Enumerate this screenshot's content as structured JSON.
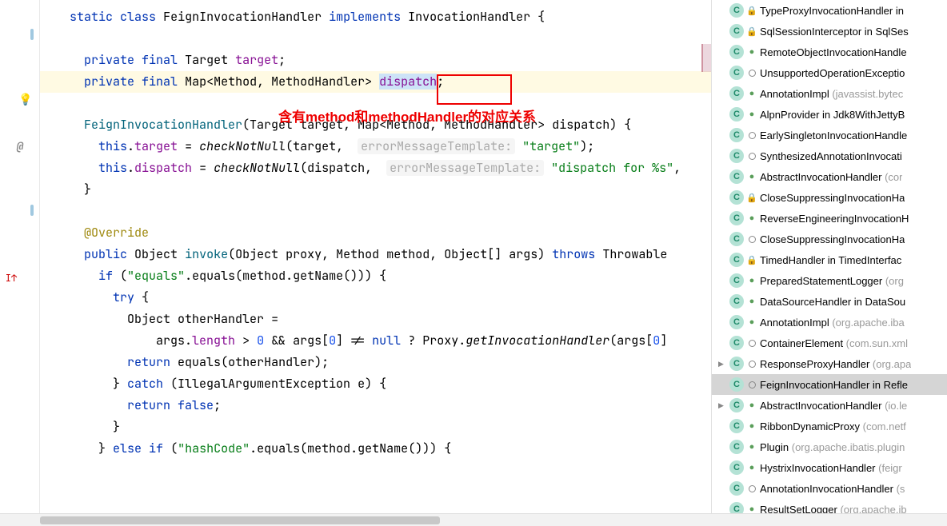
{
  "annotation": {
    "text": "含有method和methodHandler的对应关系"
  },
  "code": {
    "l1_kw1": "static",
    "l1_kw2": "class",
    "l1_cls": "FeignInvocationHandler",
    "l1_kw3": "implements",
    "l1_impl": "InvocationHandler",
    "l3_kw1": "private",
    "l3_kw2": "final",
    "l3_type": "Target",
    "l3_field": "target",
    "l4_kw1": "private",
    "l4_kw2": "final",
    "l4_type": "Map",
    "l4_gen1": "Method",
    "l4_gen2": "MethodHandler",
    "l4_field": "dispatch",
    "l6_cls": "FeignInvocationHandler",
    "l6_p1t": "Target",
    "l6_p1": "target",
    "l6_p2t": "Map",
    "l6_p2g1": "Method",
    "l6_p2g2": "MethodHandler",
    "l6_p2": "dispatch",
    "l7_this": "this",
    "l7_f": "target",
    "l7_m": "checkNotNull",
    "l7_arg": "target",
    "l7_hint": "errorMessageTemplate:",
    "l7_str": "\"target\"",
    "l8_this": "this",
    "l8_f": "dispatch",
    "l8_m": "checkNotNull",
    "l8_arg": "dispatch",
    "l8_hint": "errorMessageTemplate:",
    "l8_str": "\"dispatch for %s\"",
    "l11_anno": "@Override",
    "l12_kw1": "public",
    "l12_ret": "Object",
    "l12_m": "invoke",
    "l12_p1t": "Object",
    "l12_p1": "proxy",
    "l12_p2t": "Method",
    "l12_p2": "method",
    "l12_p3t": "Object[]",
    "l12_p3": "args",
    "l12_kw2": "throws",
    "l12_ex": "Throwable",
    "l13_kw": "if",
    "l13_str": "\"equals\"",
    "l13_m1": "equals",
    "l13_p": "method",
    "l13_m2": "getName",
    "l14_kw": "try",
    "l15_t": "Object",
    "l15_v": "otherHandler",
    "l16_v": "args",
    "l16_f": "length",
    "l16_n0": "0",
    "l16_v2": "args",
    "l16_n1": "0",
    "l16_kw": "null",
    "l16_cls": "Proxy",
    "l16_m": "getInvocationHandler",
    "l16_arg": "args",
    "l16_n2": "0",
    "l17_kw": "return",
    "l17_m": "equals",
    "l17_arg": "otherHandler",
    "l18_kw": "catch",
    "l18_t": "IllegalArgumentException",
    "l18_v": "e",
    "l19_kw": "return",
    "l19_v": "false",
    "l21_kw1": "else",
    "l21_kw2": "if",
    "l21_str": "\"hashCode\"",
    "l21_m1": "equals",
    "l21_p": "method",
    "l21_m2": "getName"
  },
  "side_items": [
    {
      "exp": "",
      "sub": "lock",
      "name": "TypeProxyInvocationHandler in",
      "pkg": ""
    },
    {
      "exp": "",
      "sub": "lock",
      "name": "SqlSessionInterceptor in SqlSes",
      "pkg": ""
    },
    {
      "exp": "",
      "sub": "impl",
      "name": "RemoteObjectInvocationHandle",
      "pkg": ""
    },
    {
      "exp": "",
      "sub": "ring",
      "name": "UnsupportedOperationExceptio",
      "pkg": ""
    },
    {
      "exp": "",
      "sub": "impl",
      "name": "AnnotationImpl ",
      "pkg": "(javassist.bytec"
    },
    {
      "exp": "",
      "sub": "impl",
      "name": "AlpnProvider in Jdk8WithJettyB",
      "pkg": ""
    },
    {
      "exp": "",
      "sub": "ring",
      "name": "EarlySingletonInvocationHandle",
      "pkg": ""
    },
    {
      "exp": "",
      "sub": "ring",
      "name": "SynthesizedAnnotationInvocati",
      "pkg": ""
    },
    {
      "exp": "",
      "sub": "impl",
      "name": "AbstractInvocationHandler ",
      "pkg": "(cor"
    },
    {
      "exp": "",
      "sub": "lock",
      "name": "CloseSuppressingInvocationHa",
      "pkg": ""
    },
    {
      "exp": "",
      "sub": "impl",
      "name": "ReverseEngineeringInvocationH",
      "pkg": ""
    },
    {
      "exp": "",
      "sub": "ring",
      "name": "CloseSuppressingInvocationHa",
      "pkg": ""
    },
    {
      "exp": "",
      "sub": "lock",
      "name": "TimedHandler in TimedInterfac",
      "pkg": ""
    },
    {
      "exp": "",
      "sub": "impl",
      "name": "PreparedStatementLogger ",
      "pkg": "(org"
    },
    {
      "exp": "",
      "sub": "impl",
      "name": "DataSourceHandler in DataSou",
      "pkg": ""
    },
    {
      "exp": "",
      "sub": "impl",
      "name": "AnnotationImpl ",
      "pkg": "(org.apache.iba"
    },
    {
      "exp": "",
      "sub": "ring",
      "name": "ContainerElement ",
      "pkg": "(com.sun.xml"
    },
    {
      "exp": "▶",
      "sub": "ring",
      "name": "ResponseProxyHandler ",
      "pkg": "(org.apa"
    },
    {
      "exp": "",
      "sub": "ring",
      "name": "FeignInvocationHandler in Refle",
      "pkg": "",
      "selected": true
    },
    {
      "exp": "▶",
      "sub": "impl",
      "name": "AbstractInvocationHandler ",
      "pkg": "(io.le"
    },
    {
      "exp": "",
      "sub": "impl",
      "name": "RibbonDynamicProxy ",
      "pkg": "(com.netf"
    },
    {
      "exp": "",
      "sub": "impl",
      "name": "Plugin ",
      "pkg": "(org.apache.ibatis.plugin"
    },
    {
      "exp": "",
      "sub": "impl",
      "name": "HystrixInvocationHandler ",
      "pkg": "(feigr"
    },
    {
      "exp": "",
      "sub": "ring",
      "name": "AnnotationInvocationHandler ",
      "pkg": "(s"
    },
    {
      "exp": "",
      "sub": "impl",
      "name": "ResultSetLogger ",
      "pkg": "(org.apache.ib"
    }
  ]
}
